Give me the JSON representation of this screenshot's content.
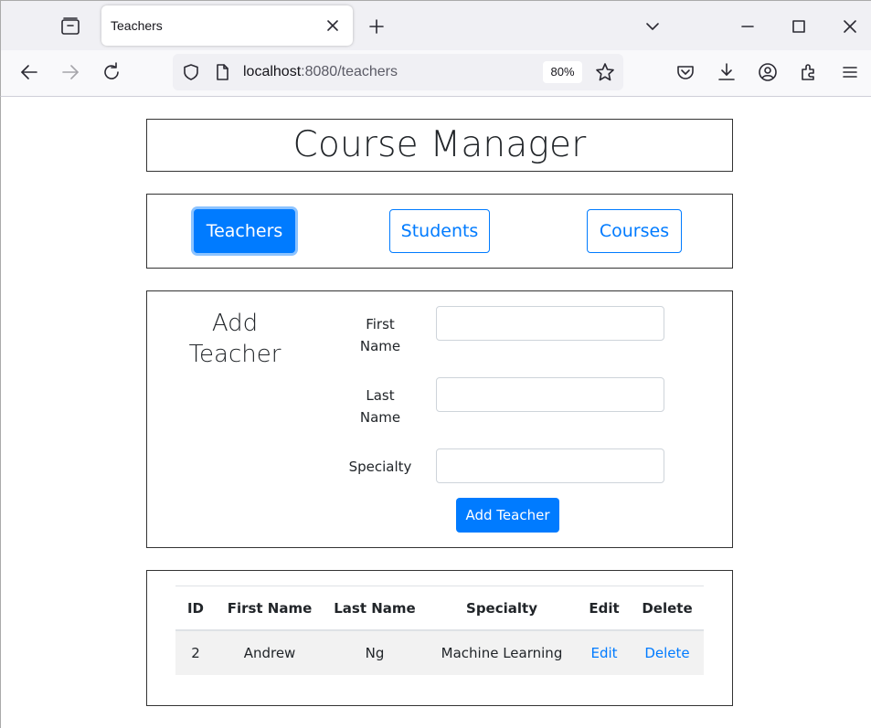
{
  "browser": {
    "tab_title": "Teachers",
    "url_host": "localhost",
    "url_rest": ":8080/teachers",
    "zoom": "80%"
  },
  "header": {
    "title": "Course Manager"
  },
  "nav": {
    "items": [
      {
        "label": "Teachers",
        "active": true
      },
      {
        "label": "Students",
        "active": false
      },
      {
        "label": "Courses",
        "active": false
      }
    ]
  },
  "form": {
    "heading_line1": "Add",
    "heading_line2": "Teacher",
    "fields": [
      {
        "label_line1": "First",
        "label_line2": "Name",
        "value": ""
      },
      {
        "label_line1": "Last",
        "label_line2": "Name",
        "value": ""
      },
      {
        "label_line1": "Specialty",
        "label_line2": "",
        "value": ""
      }
    ],
    "submit_label": "Add Teacher"
  },
  "table": {
    "columns": [
      "ID",
      "First Name",
      "Last Name",
      "Specialty",
      "Edit",
      "Delete"
    ],
    "rows": [
      {
        "id": "2",
        "first_name": "Andrew",
        "last_name": "Ng",
        "specialty": "Machine Learning",
        "edit": "Edit",
        "delete": "Delete"
      }
    ]
  },
  "colors": {
    "primary": "#007bff",
    "text": "#212529",
    "border": "#333333"
  },
  "icons": [
    "tab-list-icon",
    "close-icon",
    "plus-icon",
    "chevron-down-icon",
    "minimize-icon",
    "maximize-icon",
    "window-close-icon",
    "back-arrow-icon",
    "forward-arrow-icon",
    "reload-icon",
    "shield-icon",
    "page-icon",
    "star-icon",
    "pocket-icon",
    "download-icon",
    "account-icon",
    "extensions-icon",
    "menu-icon"
  ]
}
